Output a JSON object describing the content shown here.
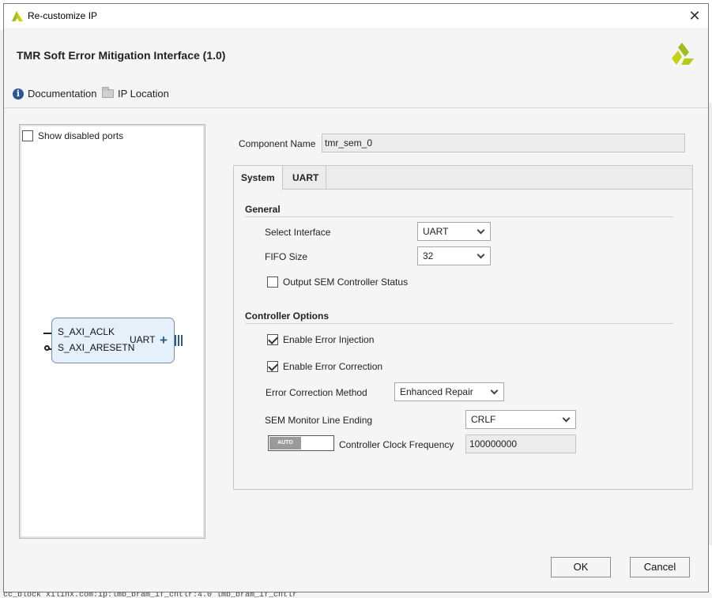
{
  "window": {
    "title": "Re-customize IP"
  },
  "header": {
    "ip_title": "TMR Soft Error Mitigation Interface (1.0)"
  },
  "links": {
    "documentation": "Documentation",
    "ip_location": "IP Location"
  },
  "left_panel": {
    "show_disabled_ports": {
      "label": "Show disabled ports",
      "checked": false
    },
    "block": {
      "ports_in": [
        "S_AXI_ACLK",
        "S_AXI_ARESETN"
      ],
      "port_out": "UART"
    }
  },
  "component": {
    "label": "Component Name",
    "value": "tmr_sem_0"
  },
  "tabs": [
    {
      "label": "System",
      "active": true
    },
    {
      "label": "UART",
      "active": false
    }
  ],
  "general": {
    "heading": "General",
    "select_interface": {
      "label": "Select Interface",
      "value": "UART"
    },
    "fifo_size": {
      "label": "FIFO Size",
      "value": "32"
    },
    "output_status": {
      "label": "Output SEM Controller Status",
      "checked": false
    }
  },
  "controller": {
    "heading": "Controller Options",
    "error_injection": {
      "label": "Enable Error Injection",
      "checked": true
    },
    "error_correction": {
      "label": "Enable Error Correction",
      "checked": true
    },
    "correction_method": {
      "label": "Error Correction Method",
      "value": "Enhanced Repair"
    },
    "line_ending": {
      "label": "SEM Monitor Line Ending",
      "value": "CRLF"
    },
    "clock_frequency": {
      "toggle": "AUTO",
      "label": "Controller Clock Frequency",
      "value": "100000000"
    }
  },
  "buttons": {
    "ok": "OK",
    "cancel": "Cancel"
  },
  "background_text": "cc_block    xilinx.com:ip:lmb_bram_if_cntlr:4.0    lmb_bram_if_cntlr",
  "colors": {
    "accent": "#2a5d8a",
    "logo_green": "#9bbf1e",
    "block_fill": "#e6f0fa"
  }
}
